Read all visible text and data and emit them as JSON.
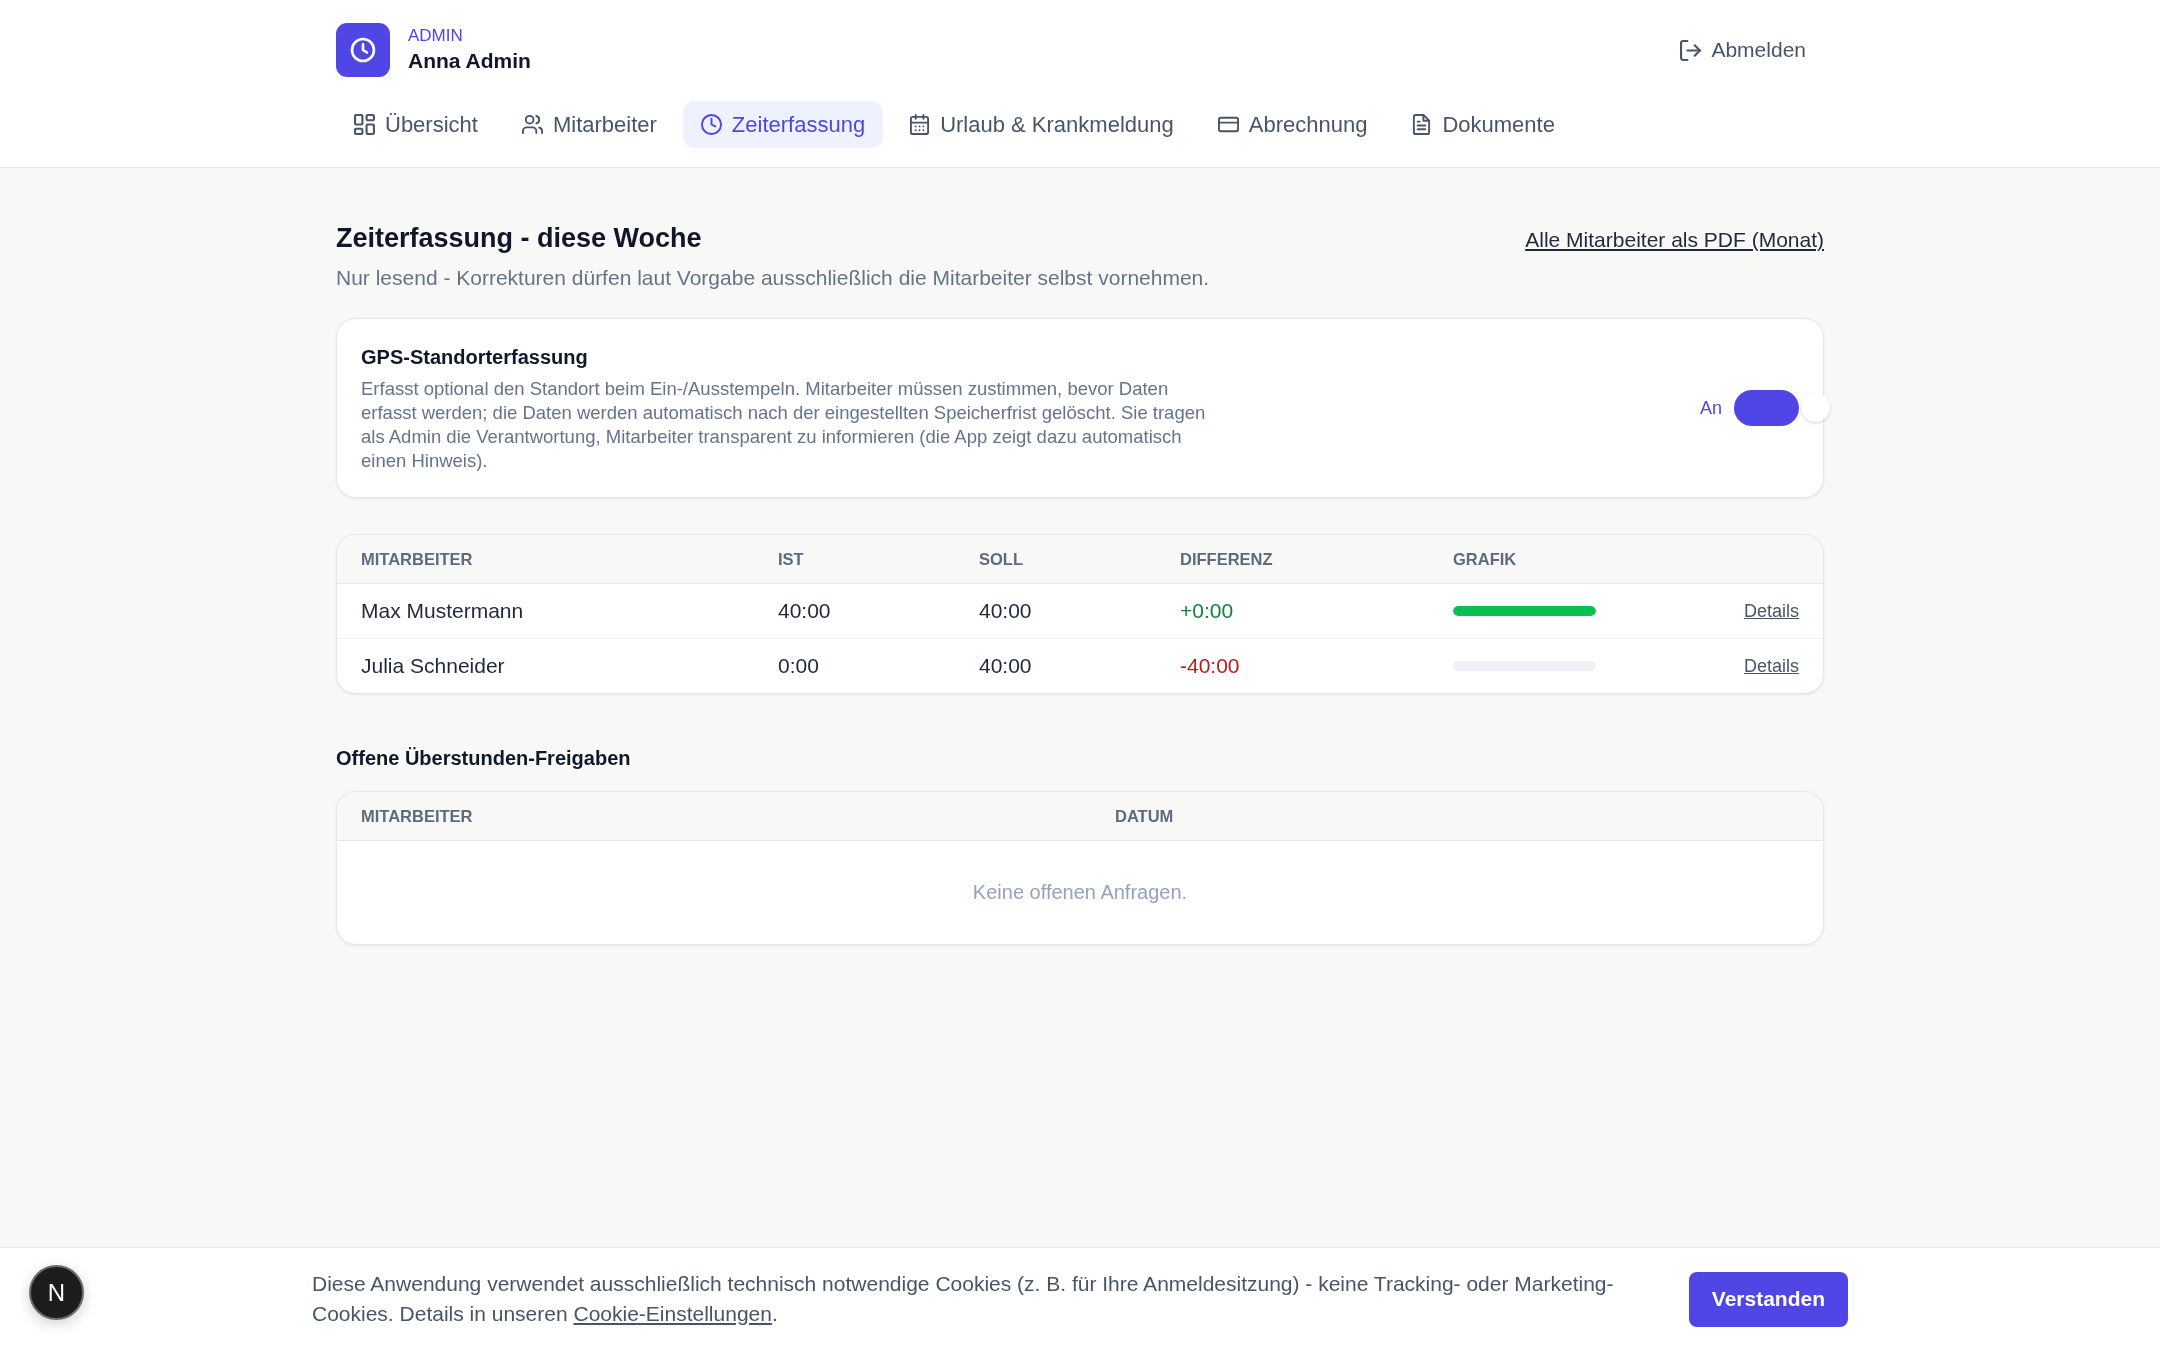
{
  "header": {
    "role": "ADMIN",
    "user_name": "Anna Admin",
    "logout": "Abmelden"
  },
  "nav": {
    "tabs": [
      {
        "label": "Übersicht",
        "kind": "overview",
        "selected": false
      },
      {
        "label": "Mitarbeiter",
        "kind": "staff",
        "selected": false
      },
      {
        "label": "Zeiterfassung",
        "kind": "time",
        "selected": true
      },
      {
        "label": "Urlaub & Krankmeldung",
        "kind": "leave",
        "selected": false
      },
      {
        "label": "Abrechnung",
        "kind": "billing",
        "selected": false
      },
      {
        "label": "Dokumente",
        "kind": "documents",
        "selected": false
      }
    ]
  },
  "page": {
    "title": "Zeiterfassung - diese Woche",
    "export_link": "Alle Mitarbeiter als PDF (Monat)",
    "subtitle": "Nur lesend - Korrekturen dürfen laut Vorgabe ausschließlich die Mitarbeiter selbst vornehmen."
  },
  "gps_card": {
    "title": "GPS-Standorterfassung",
    "description": "Erfasst optional den Standort beim Ein-/Ausstempeln. Mitarbeiter müssen zustimmen, bevor Daten erfasst werden; die Daten werden automatisch nach der eingestellten Speicherfrist gelöscht. Sie tragen als Admin die Verantwortung, Mitarbeiter transparent zu informieren (die App zeigt dazu automatisch einen Hinweis).",
    "toggle": {
      "label": "An",
      "on": true
    }
  },
  "hours_table": {
    "columns": [
      "MITARBEITER",
      "IST",
      "SOLL",
      "DIFFERENZ",
      "GRAFIK"
    ],
    "rows": [
      {
        "employee": "Max Mustermann",
        "actual": "40:00",
        "target": "40:00",
        "difference": "+0:00",
        "color": "#15803d",
        "level": 1,
        "link": "Details"
      },
      {
        "employee": "Julia Schneider",
        "actual": "0:00",
        "target": "40:00",
        "difference": "-40:00",
        "color": "#b91c1c",
        "level": 0,
        "link": "Details"
      }
    ]
  },
  "approvals": {
    "title": "Offene Überstunden-Freigaben",
    "columns": [
      "MITARBEITER",
      "DATUM"
    ],
    "empty_message": "Keine offenen Anfragen."
  },
  "cookie_banner": {
    "text": "Diese Anwendung verwendet ausschließlich technisch notwendige Cookies (z. B. für Ihre Anmeldesitzung) - keine Tracking- oder Marketing-Cookies. Details in unseren ",
    "link": "Cookie-Einstellungen",
    "text_end": ".",
    "button": "Verstanden"
  },
  "dev_badge": {
    "label": "N"
  }
}
